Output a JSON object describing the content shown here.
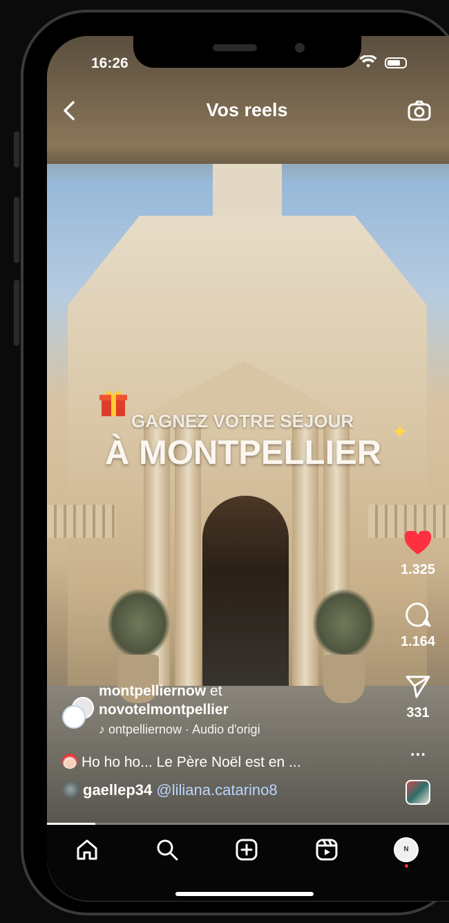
{
  "status_bar": {
    "time": "16:26"
  },
  "header": {
    "title": "Vos reels"
  },
  "promo": {
    "line1": "GAGNEZ VOTRE SÉJOUR",
    "line2": "À MONTPELLIER"
  },
  "actions": {
    "likes": "1.325",
    "comments": "1.164",
    "shares": "331",
    "more": "..."
  },
  "post": {
    "author1": "montpelliernow",
    "connector": "et",
    "author2": "novotelmontpellier",
    "audio": "♪ ontpelliernow · Audio d'origi",
    "caption": "Ho ho ho... Le Père Noël est en ...",
    "tag_user": "gaellep34",
    "tag_mention": "@liliana.catarino8"
  },
  "progress": {
    "fraction": 0.12
  },
  "profile": {
    "initial": "N"
  },
  "colors": {
    "like": "#ff3040",
    "mention": "#b9d6ff",
    "navbar": "#060606"
  },
  "icons": {
    "back": "chevron-left-icon",
    "camera": "camera-icon",
    "like": "heart-icon",
    "comment": "comment-bubble-icon",
    "share": "paper-plane-icon",
    "nav": [
      "home-icon",
      "search-icon",
      "create-plus-icon",
      "reels-icon",
      "profile-avatar"
    ]
  }
}
